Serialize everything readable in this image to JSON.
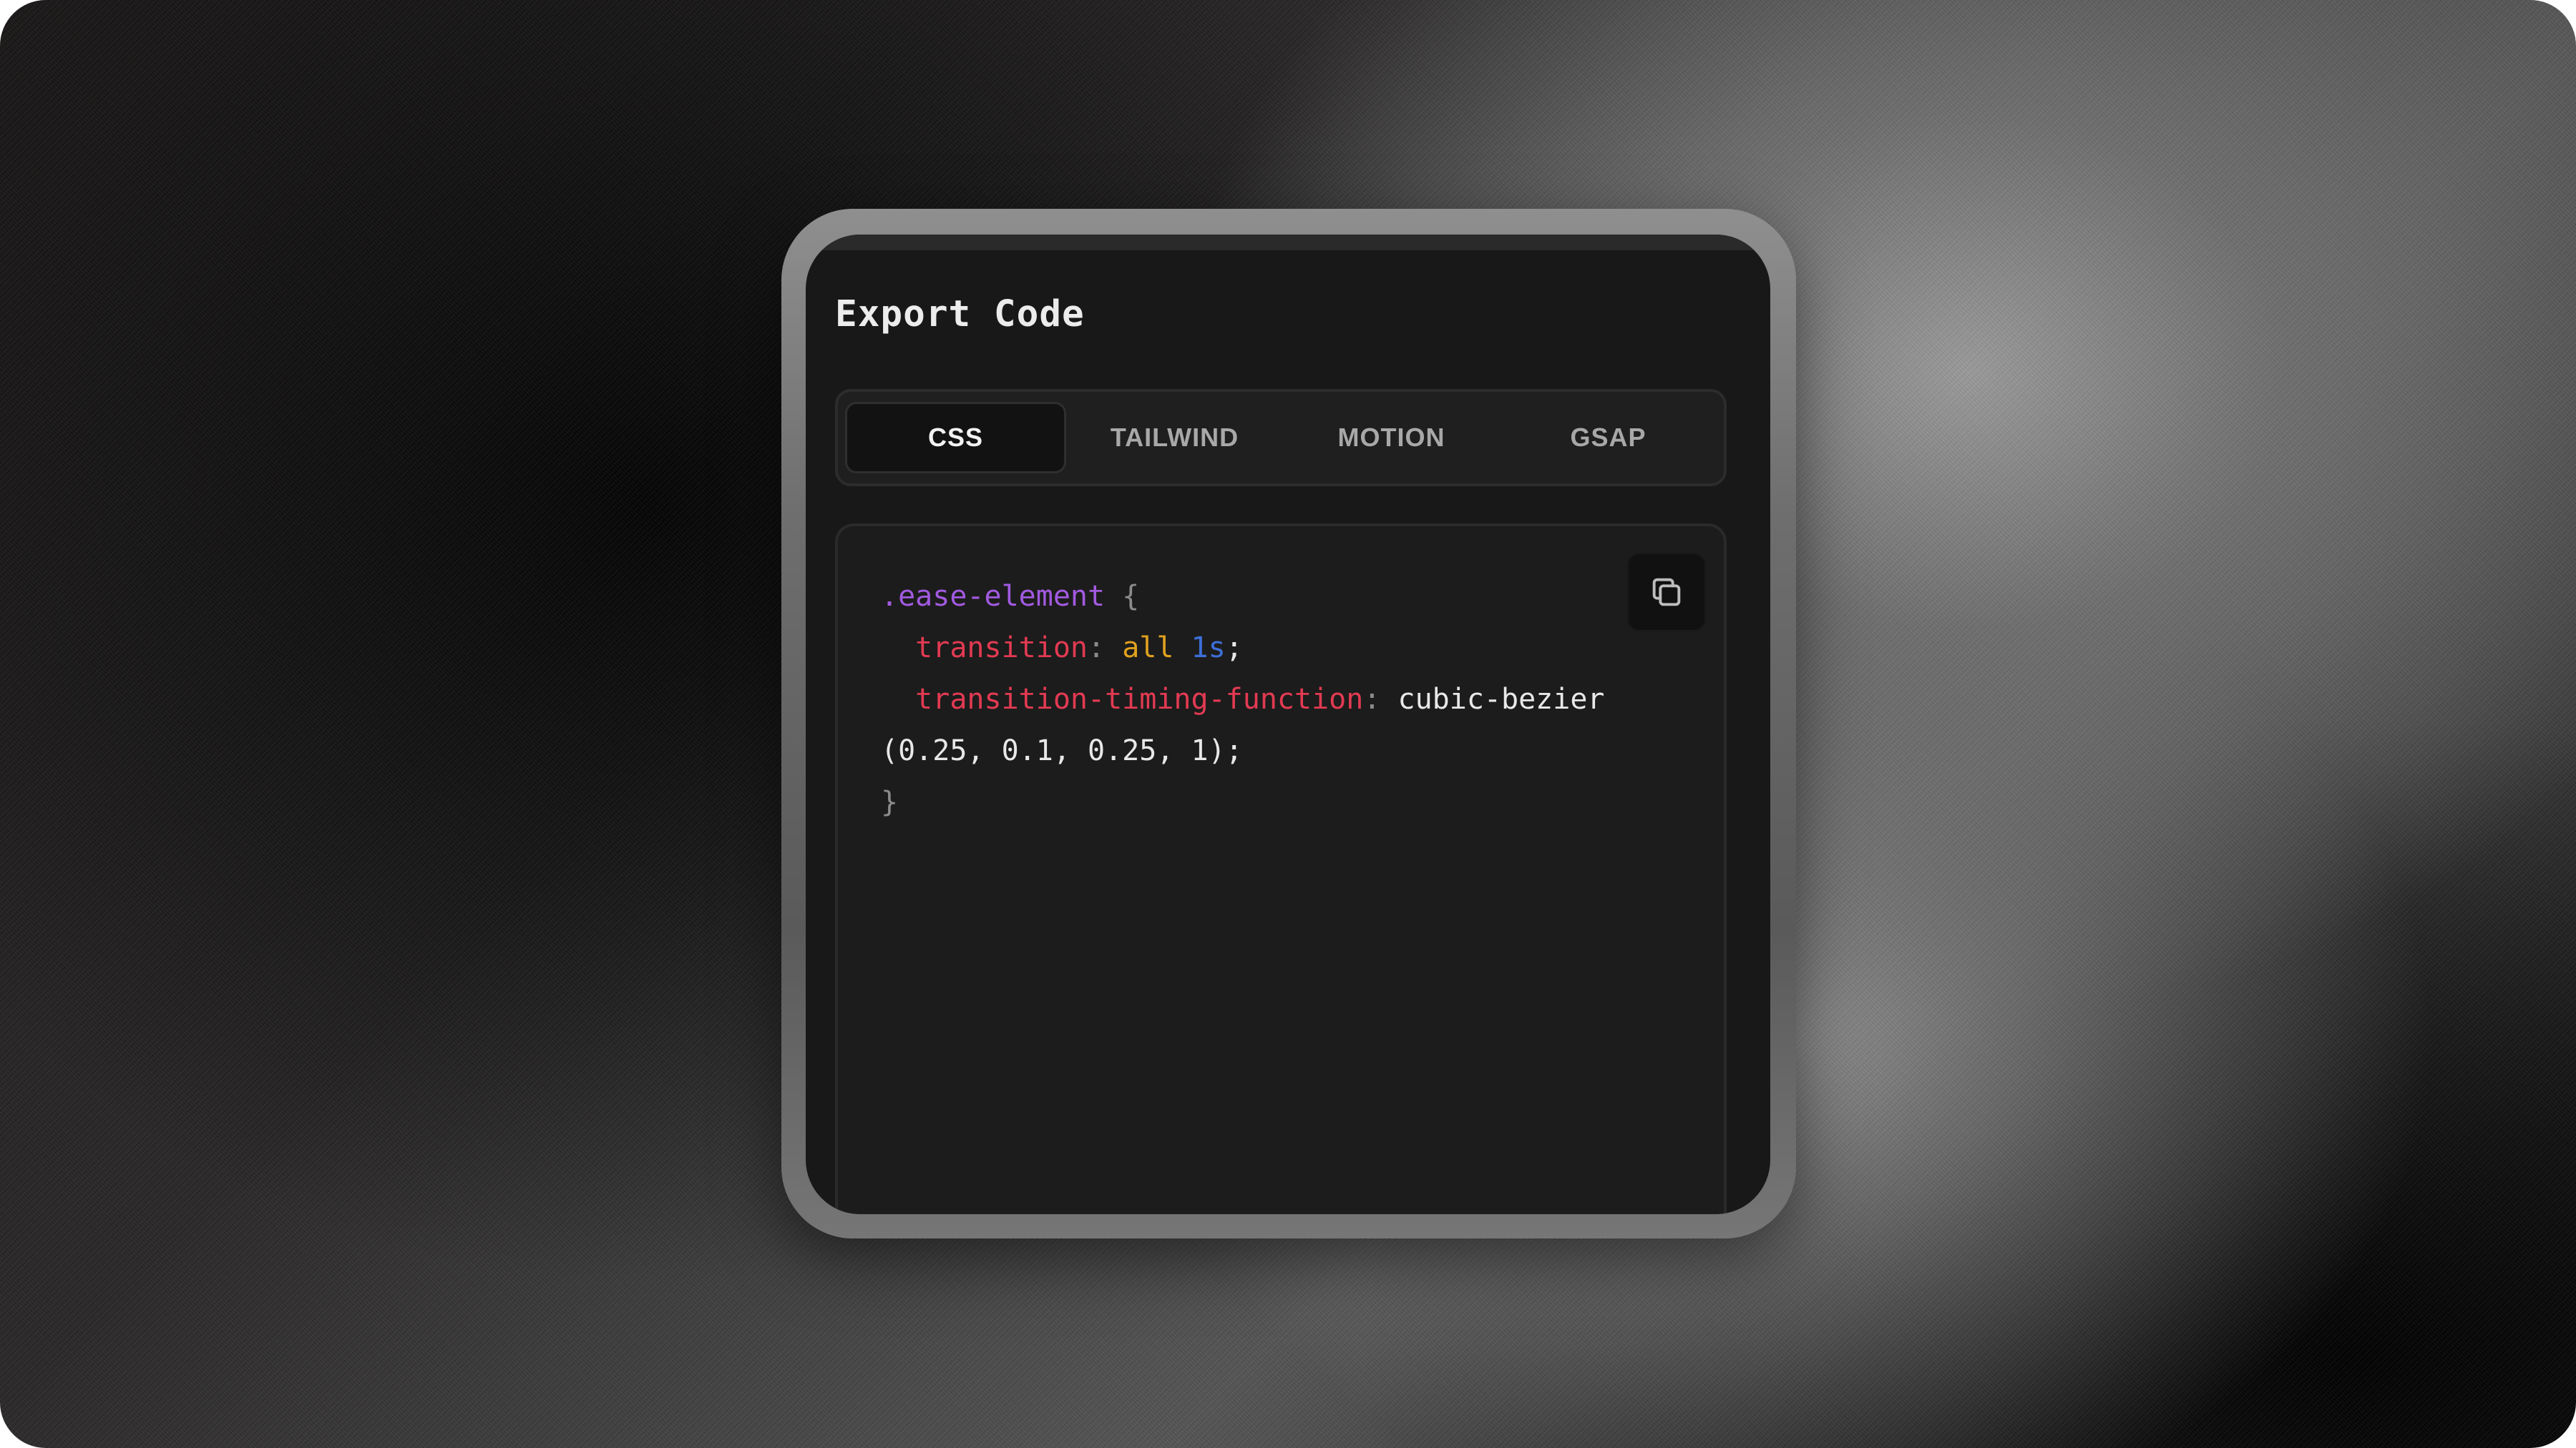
{
  "panel": {
    "title": "Export Code"
  },
  "tabs": [
    {
      "label": "CSS",
      "active": true
    },
    {
      "label": "TAILWIND",
      "active": false
    },
    {
      "label": "MOTION",
      "active": false
    },
    {
      "label": "GSAP",
      "active": false
    }
  ],
  "code": {
    "selector": ".ease-element",
    "open_brace": "{",
    "close_brace": "}",
    "prop1": "transition",
    "prop1_keyword": "all",
    "prop1_number": "1s",
    "prop2": "transition-timing-function",
    "prop2_value_line1": "cubic-bezier",
    "prop2_value_line2": "(0.25, 0.1, 0.25, 1);",
    "colon": ":",
    "semicolon": ";"
  },
  "icons": {
    "copy": "copy-icon"
  },
  "colors": {
    "selector": "#a25ae0",
    "property": "#e23a52",
    "keyword": "#e0a11f",
    "number": "#3d6fd8",
    "panel_bg": "#181818"
  }
}
